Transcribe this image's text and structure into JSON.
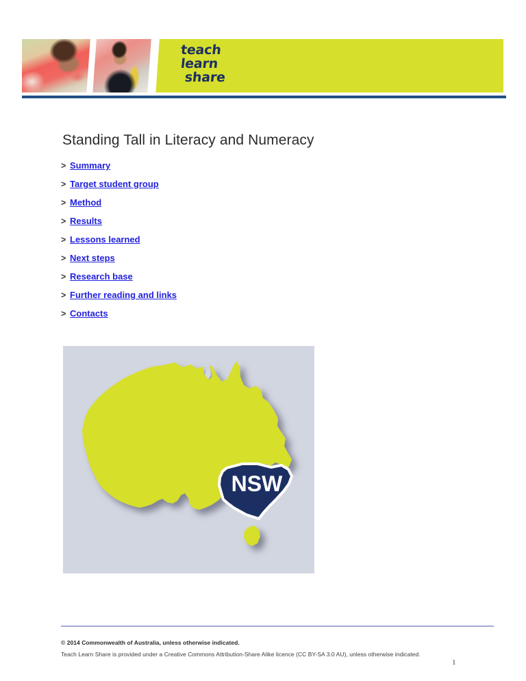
{
  "header": {
    "wordmark": {
      "line1": "teach",
      "line2": "learn",
      "line3": "share"
    },
    "lime_color": "#d6df2c",
    "navy_color": "#1c2f63",
    "rule_color": "#1c4a80",
    "photo_1_alt": "child writing with red pencil",
    "photo_2_alt": "boy in black and yellow jacket writing"
  },
  "main": {
    "title": "Standing Tall in Literacy and Numeracy",
    "toc_marker": ">",
    "toc": [
      {
        "label": "Summary"
      },
      {
        "label": "Target student group"
      },
      {
        "label": "Method"
      },
      {
        "label": "Results"
      },
      {
        "label": "Lessons learned"
      },
      {
        "label": "Next steps"
      },
      {
        "label": "Research base"
      },
      {
        "label": "Further reading and links"
      },
      {
        "label": "Contacts"
      }
    ],
    "link_color": "#2222dd"
  },
  "map": {
    "caption_state": "NSW",
    "background_color": "#d2d6e0",
    "landmass_color": "#d6df2c",
    "highlight_color": "#1c2f63",
    "highlight_border_color": "#ffffff",
    "shadow_color": "#9a9db0",
    "alt": "Map of Australia with New South Wales highlighted"
  },
  "footer": {
    "copyright": "© 2014 Commonwealth of Australia, unless otherwise indicated.",
    "licence": "Teach Learn Share is provided under a Creative Commons Attribution-Share Alike licence (CC BY-SA 3.0 AU), unless otherwise indicated.",
    "page_number": "1",
    "rule_color": "#a7a7d8"
  }
}
